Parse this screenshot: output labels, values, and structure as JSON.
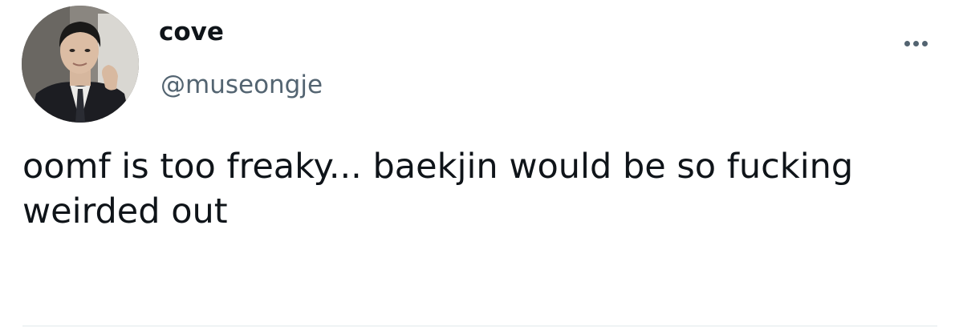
{
  "tweet": {
    "author": {
      "display_name": "cove",
      "handle": "@museongje",
      "avatar_icon": "profile-photo"
    },
    "more_icon": "more-horizontal-icon",
    "text": "oomf is too freaky... baekjin would be so fucking weirded out"
  },
  "colors": {
    "text_primary": "#0f1419",
    "text_secondary": "#536471",
    "divider": "#eff3f4",
    "background": "#ffffff"
  }
}
